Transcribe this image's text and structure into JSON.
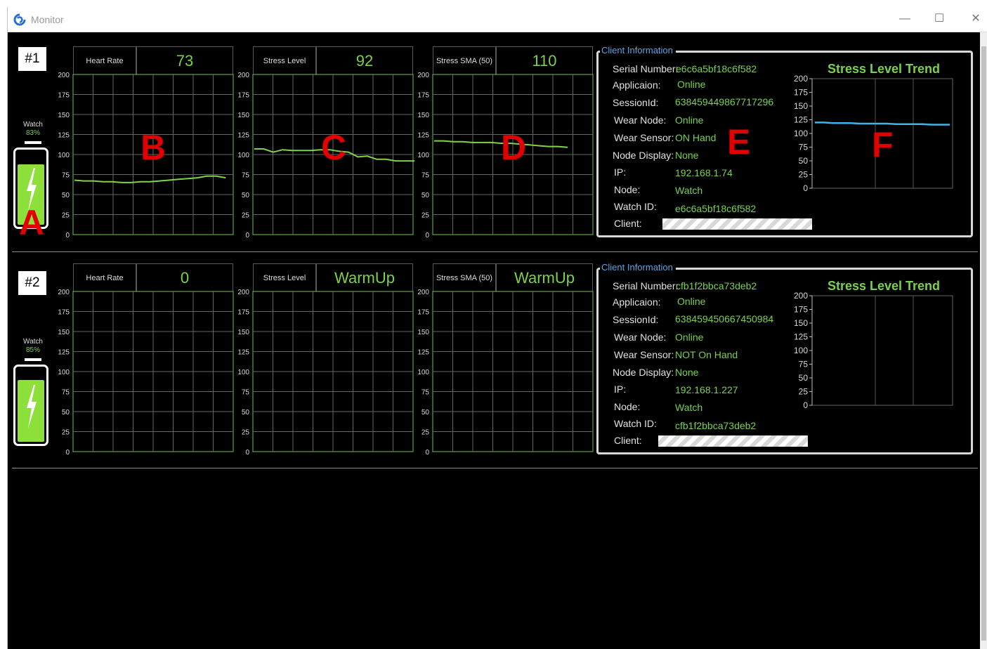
{
  "window": {
    "title": "Monitor",
    "minimize": "—",
    "maximize": "☐",
    "close": "✕"
  },
  "axis_ticks": [
    "200",
    "175",
    "150",
    "125",
    "100",
    "75",
    "50",
    "25",
    "0"
  ],
  "trend_ticks": [
    "200",
    "175",
    "150",
    "125",
    "100",
    "75",
    "50",
    "25",
    "0"
  ],
  "colors": {
    "grid": "#6fc24a",
    "line": "#7fd34a",
    "trend_line": "#3db5e6",
    "value": "#78d24b",
    "legend": "#5aa3e6",
    "battery": "#8de03a"
  },
  "annotations": {
    "a": "A",
    "b": "B",
    "c": "C",
    "d": "D",
    "e": "E",
    "f": "F"
  },
  "clients": [
    {
      "index": "#1",
      "watch_label": "Watch",
      "battery_pct": "83%",
      "battery_level": 0.83,
      "charts": [
        {
          "label": "Heart Rate",
          "value": "73",
          "ylim": [
            0,
            200
          ],
          "points": [
            68,
            67,
            67,
            66,
            66,
            65,
            65,
            66,
            66,
            67,
            68,
            69,
            70,
            71,
            73,
            73,
            71
          ]
        },
        {
          "label": "Stress Level",
          "value": "92",
          "ylim": [
            0,
            200
          ],
          "points": [
            107,
            107,
            103,
            106,
            105,
            105,
            105,
            106,
            106,
            104,
            103,
            97,
            98,
            94,
            94,
            92,
            92,
            92
          ]
        },
        {
          "label": "Stress SMA (50)",
          "value": "110",
          "ylim": [
            0,
            200
          ],
          "points": [
            117,
            117,
            116,
            116,
            115,
            115,
            115,
            114,
            114,
            113,
            112,
            111,
            110,
            110,
            109
          ]
        }
      ],
      "info": {
        "legend": "Client Information",
        "rows": [
          {
            "k": "Serial Number:",
            "v": "e6c6a5bf18c6f582"
          },
          {
            "k": "Applicaion:",
            "v": "Online"
          },
          {
            "k": "SessionId:",
            "v": "638459449867717296"
          },
          {
            "k": "Wear Node:",
            "v": "Online"
          },
          {
            "k": "Wear Sensor:",
            "v": "ON Hand"
          },
          {
            "k": "Node Display:",
            "v": "None"
          },
          {
            "k": "IP:",
            "v": "192.168.1.74"
          },
          {
            "k": "Node:",
            "v": "Watch"
          },
          {
            "k": "Watch ID:",
            "v": "e6c6a5bf18c6f582"
          },
          {
            "k": "Client:",
            "v": ""
          }
        ]
      },
      "trend": {
        "title": "Stress Level Trend",
        "ylim": [
          0,
          200
        ],
        "points": [
          120,
          120,
          119,
          119,
          119,
          118,
          118,
          118,
          118,
          117,
          117,
          117,
          117,
          116,
          116,
          116
        ]
      }
    },
    {
      "index": "#2",
      "watch_label": "Watch",
      "battery_pct": "85%",
      "battery_level": 0.85,
      "charts": [
        {
          "label": "Heart Rate",
          "value": "0",
          "ylim": [
            0,
            200
          ],
          "points": []
        },
        {
          "label": "Stress Level",
          "value": "WarmUp",
          "ylim": [
            0,
            200
          ],
          "points": []
        },
        {
          "label": "Stress SMA (50)",
          "value": "WarmUp",
          "ylim": [
            0,
            200
          ],
          "points": []
        }
      ],
      "info": {
        "legend": "Client Information",
        "rows": [
          {
            "k": "Serial Number:",
            "v": "cfb1f2bbca73deb2"
          },
          {
            "k": "Applicaion:",
            "v": "Online"
          },
          {
            "k": "SessionId:",
            "v": "638459450667450984"
          },
          {
            "k": "Wear Node:",
            "v": "Online"
          },
          {
            "k": "Wear Sensor:",
            "v": "NOT On Hand"
          },
          {
            "k": "Node Display:",
            "v": "None"
          },
          {
            "k": "IP:",
            "v": "192.168.1.227"
          },
          {
            "k": "Node:",
            "v": "Watch"
          },
          {
            "k": "Watch ID:",
            "v": "cfb1f2bbca73deb2"
          },
          {
            "k": "Client:",
            "v": ""
          }
        ]
      },
      "trend": {
        "title": "Stress Level Trend",
        "ylim": [
          0,
          200
        ],
        "points": []
      }
    }
  ],
  "chart_data": [
    {
      "type": "line",
      "title": "Heart Rate",
      "ylim": [
        0,
        200
      ],
      "series": [
        {
          "values": [
            68,
            67,
            67,
            66,
            66,
            65,
            65,
            66,
            66,
            67,
            68,
            69,
            70,
            71,
            73,
            73,
            71
          ]
        }
      ]
    },
    {
      "type": "line",
      "title": "Stress Level",
      "ylim": [
        0,
        200
      ],
      "series": [
        {
          "values": [
            107,
            107,
            103,
            106,
            105,
            105,
            105,
            106,
            106,
            104,
            103,
            97,
            98,
            94,
            94,
            92,
            92,
            92
          ]
        }
      ]
    },
    {
      "type": "line",
      "title": "Stress SMA (50)",
      "ylim": [
        0,
        200
      ],
      "series": [
        {
          "values": [
            117,
            117,
            116,
            116,
            115,
            115,
            115,
            114,
            114,
            113,
            112,
            111,
            110,
            110,
            109
          ]
        }
      ]
    },
    {
      "type": "line",
      "title": "Stress Level Trend",
      "ylim": [
        0,
        200
      ],
      "series": [
        {
          "values": [
            120,
            120,
            119,
            119,
            119,
            118,
            118,
            118,
            118,
            117,
            117,
            117,
            117,
            116,
            116,
            116
          ]
        }
      ]
    },
    {
      "type": "line",
      "title": "Heart Rate",
      "ylim": [
        0,
        200
      ],
      "series": []
    },
    {
      "type": "line",
      "title": "Stress Level",
      "ylim": [
        0,
        200
      ],
      "series": []
    },
    {
      "type": "line",
      "title": "Stress SMA (50)",
      "ylim": [
        0,
        200
      ],
      "series": []
    },
    {
      "type": "line",
      "title": "Stress Level Trend",
      "ylim": [
        0,
        200
      ],
      "series": []
    }
  ]
}
